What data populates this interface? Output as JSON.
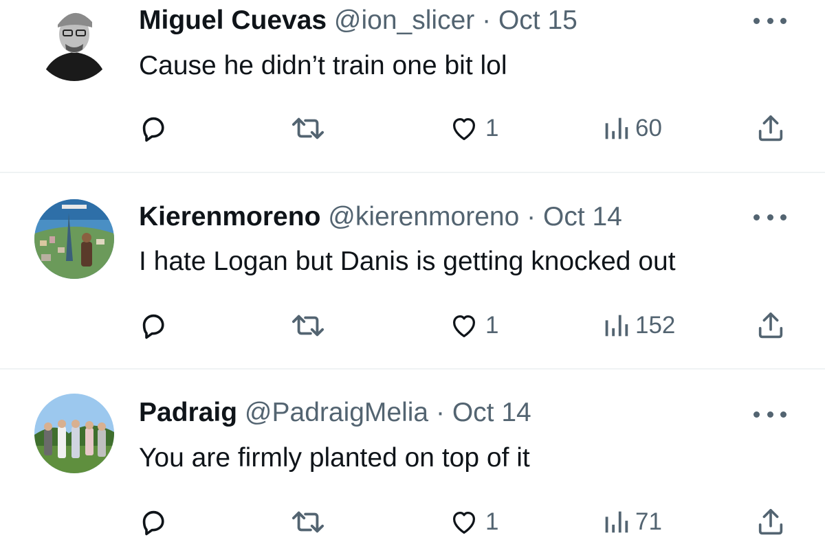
{
  "tweets": [
    {
      "name": "Miguel Cuevas",
      "handle": "@ion_slicer",
      "sep": "·",
      "date": "Oct 15",
      "text": "Cause he didn’t train one bit lol",
      "likes": "1",
      "views": "60"
    },
    {
      "name": "Kierenmoreno",
      "handle": "@kierenmoreno",
      "sep": "·",
      "date": "Oct 14",
      "text": "I hate Logan but Danis is getting knocked out",
      "likes": "1",
      "views": "152"
    },
    {
      "name": "Padraig",
      "handle": "@PadraigMelia",
      "sep": "·",
      "date": "Oct 14",
      "text": "You are firmly planted on top of it",
      "likes": "1",
      "views": "71"
    }
  ],
  "icons": {
    "reply": "reply-icon",
    "retweet": "retweet-icon",
    "like": "heart-icon",
    "views": "views-icon",
    "share": "share-icon",
    "more": "more-icon"
  },
  "colors": {
    "text": "#0f1419",
    "secondary": "#536471",
    "divider": "#eff3f4"
  }
}
